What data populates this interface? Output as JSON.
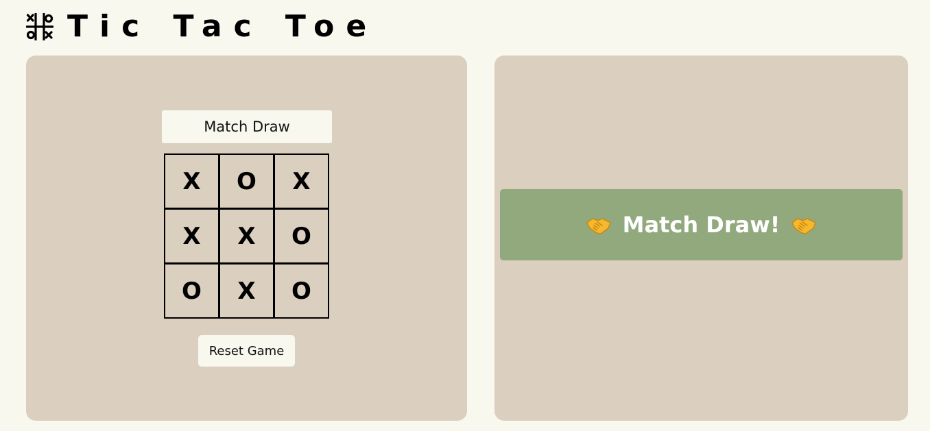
{
  "header": {
    "title": "Tic Tac Toe",
    "logo_icon": "tic-tac-toe-icon"
  },
  "game": {
    "status": "Match Draw",
    "board": [
      [
        "X",
        "O",
        "X"
      ],
      [
        "X",
        "X",
        "O"
      ],
      [
        "O",
        "X",
        "O"
      ]
    ],
    "reset_label": "Reset Game"
  },
  "result": {
    "message": "Match Draw!",
    "icon": "handshake-icon"
  },
  "colors": {
    "page_background": "#f9f8ee",
    "panel_background": "#dbcfbf",
    "result_banner": "#91a97d",
    "handshake": "#f5b82e"
  }
}
